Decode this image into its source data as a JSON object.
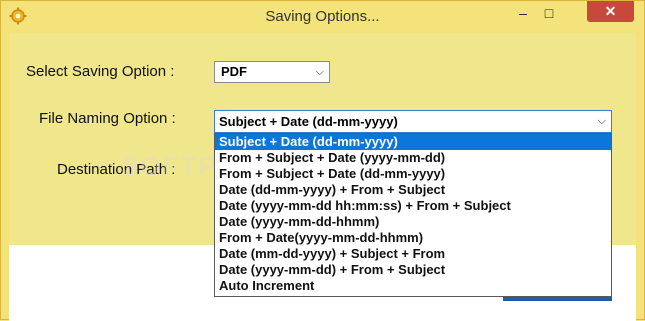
{
  "window": {
    "title": "Saving Options...",
    "controls": {
      "minimize": "–",
      "maximize": "□",
      "close": "✕"
    }
  },
  "labels": {
    "saving_option": "Select Saving Option :",
    "file_naming": "File Naming Option :",
    "destination_path": "Destination Path :"
  },
  "saving_select": {
    "value": "PDF"
  },
  "naming_select": {
    "value": "Subject + Date (dd-mm-yyyy)",
    "options": [
      "Subject + Date (dd-mm-yyyy)",
      "From + Subject + Date (yyyy-mm-dd)",
      "From + Subject + Date (dd-mm-yyyy)",
      "Date (dd-mm-yyyy) + From + Subject",
      "Date (yyyy-mm-dd hh:mm:ss) + From + Subject",
      "Date (yyyy-mm-dd-hhmm)",
      "From + Date(yyyy-mm-dd-hhmm)",
      "Date (mm-dd-yyyy) + Subject + From",
      "Date (yyyy-mm-dd) + From + Subject",
      "Auto Increment"
    ],
    "selected_index": 0
  },
  "watermark": "SOFTP",
  "colors": {
    "accent": "#0d77d9",
    "background": "#f0e68c",
    "close": "#c7493a"
  },
  "icons": {
    "app": "gear-icon",
    "chevron": "chevron-down-icon"
  }
}
